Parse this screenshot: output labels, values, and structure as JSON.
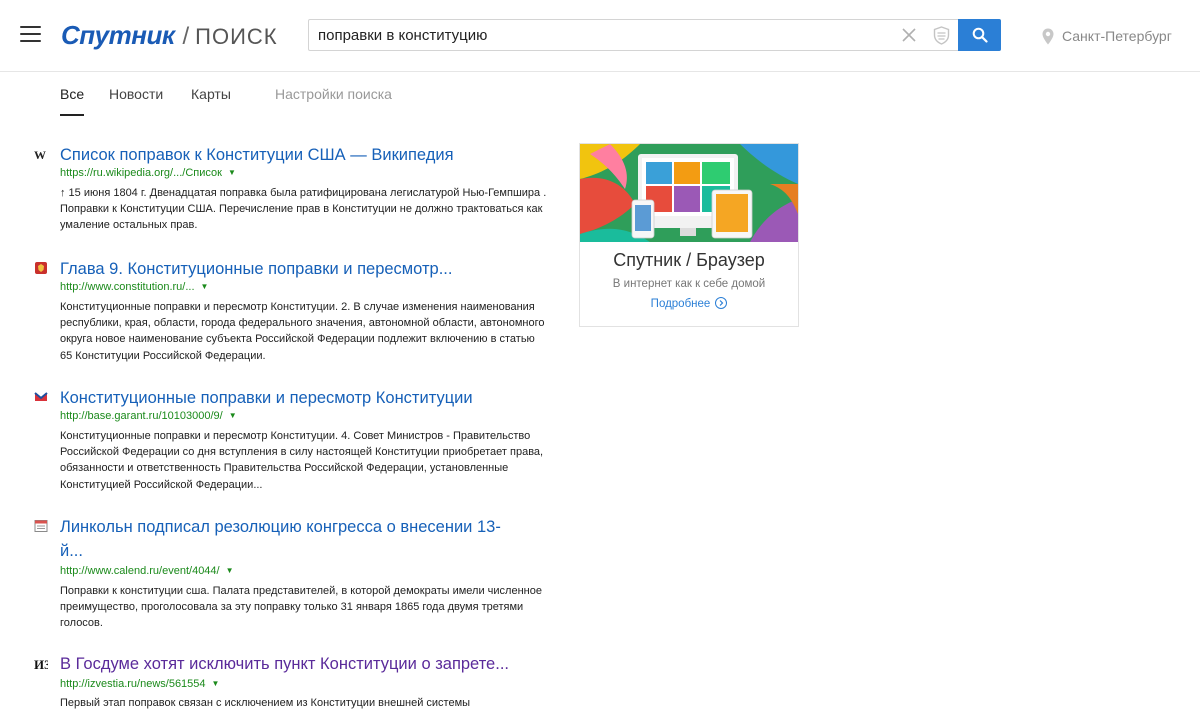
{
  "header": {
    "logo_brand": "Спутник",
    "logo_separator": "/",
    "logo_section": "ПОИСК",
    "search_value": "поправки в конституцию",
    "location": "Санкт-Петербург"
  },
  "tabs": [
    {
      "label": "Все",
      "active": true
    },
    {
      "label": "Новости",
      "active": false
    },
    {
      "label": "Карты",
      "active": false
    },
    {
      "label": "Настройки поиска",
      "active": false
    }
  ],
  "results": [
    {
      "favicon": "wikipedia-icon",
      "title": "Список поправок к Конституции США — Википедия",
      "url": "https://ru.wikipedia.org/.../Список",
      "snippet": "↑ 15 июня 1804 г. Двенадцатая поправка была ратифицирована легислатурой Нью-Гемпшира . Поправки к Конституции США. Перечисление прав в Конституции не должно трактоваться как умаление остальных прав."
    },
    {
      "favicon": "russian-emblem-icon",
      "title": "Глава 9. Конституционные поправки и пересмотр...",
      "url": "http://www.constitution.ru/...",
      "snippet": "Конституционные поправки и пересмотр Конституции. 2. В случае изменения наименования республики, края, области, города федерального значения, автономной области, автономного округа новое наименование субъекта Российской Федерации подлежит включению в статью 65 Конституции Российской Федерации."
    },
    {
      "favicon": "garant-icon",
      "title": "Конституционные поправки и пересмотр Конституции",
      "url": "http://base.garant.ru/10103000/9/",
      "snippet": "Конституционные поправки и пересмотр Конституции. 4. Совет Министров - Правительство Российской Федерации со дня вступления в силу настоящей Конституции приобретает права, обязанности и ответственность Правительства Российской Федерации, установленные Конституцией Российской Федерации..."
    },
    {
      "favicon": "calendar-icon",
      "title_line1": "Линкольн подписал резолюцию конгресса о внесении 13-",
      "title_line2": "й...",
      "url": "http://www.calend.ru/event/4044/",
      "snippet": "Поправки к конституции сша. Палата представителей, в которой демократы имели численное преимущество, проголосовала за эту поправку только 31 января 1865 года двумя третями голосов."
    },
    {
      "favicon": "izvestia-icon",
      "title": "В Госдуме хотят исключить пункт Конституции о запрете...",
      "url": "http://izvestia.ru/news/561554",
      "snippet": "Первый этап поправок связан с исключением из Конституции внешней системы"
    }
  ],
  "ad": {
    "title": "Спутник / Браузер",
    "subtitle": "В интернет как к себе домой",
    "more_label": "Подробнее"
  },
  "colors": {
    "link": "#1660b8",
    "visited": "#5a2a9a",
    "url": "#1b8a1b",
    "accent": "#2b7fd6"
  }
}
